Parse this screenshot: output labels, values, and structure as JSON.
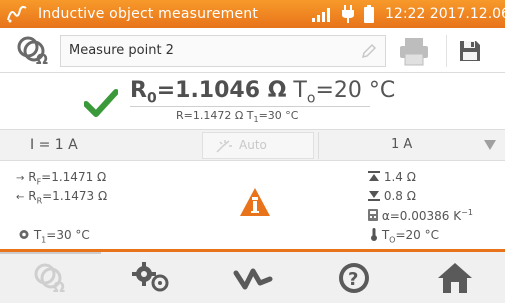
{
  "status_bar": {
    "title": "Inductive object measurement",
    "clock": "12:22 2017.12.06"
  },
  "measure_point": {
    "name": "Measure point 2"
  },
  "result": {
    "r0_label": "R",
    "r0_sub": "0",
    "r0_value": "=1.1046 Ω",
    "t0_label": "T",
    "t0_sub": "o",
    "t0_value": "=20 °C",
    "r_line": "R=1.1472 Ω T",
    "r_line_sub": "1",
    "r_line_end": "=30 °C"
  },
  "current": {
    "label": "I = 1 A",
    "auto_label": "Auto",
    "selected": "1 A"
  },
  "details": {
    "rf_label": "R",
    "rf_sub": "F",
    "rf_value": "=1.1471 Ω",
    "rr_label": "R",
    "rr_sub": "R",
    "rr_value": "=1.1473 Ω",
    "t1_label": "T",
    "t1_sub": "1",
    "t1_value": "=30 °C",
    "upper_limit": "1.4 Ω",
    "lower_limit": "0.8 Ω",
    "alpha": "α=0.00386 K",
    "alpha_exp": "−1",
    "t0_label": "T",
    "t0_sub": "O",
    "t0_value": "=20 °C"
  },
  "icons": {
    "logo": "sonel-logo-icon",
    "signal": "signal-icon",
    "plug": "plug-icon",
    "battery": "battery-icon",
    "measure_type": "resistance-probe-icon",
    "pencil": "pencil-icon",
    "print": "printer-icon",
    "save": "save-icon",
    "check": "checkmark-icon",
    "warning": "warning-icon",
    "toolbar": [
      "measure-mode-icon",
      "settings-icon",
      "waveform-icon",
      "help-icon",
      "home-icon"
    ]
  },
  "colors": {
    "accent": "#e8731a",
    "check": "#3a9a3a",
    "icon_gray": "#6a6a6a"
  }
}
